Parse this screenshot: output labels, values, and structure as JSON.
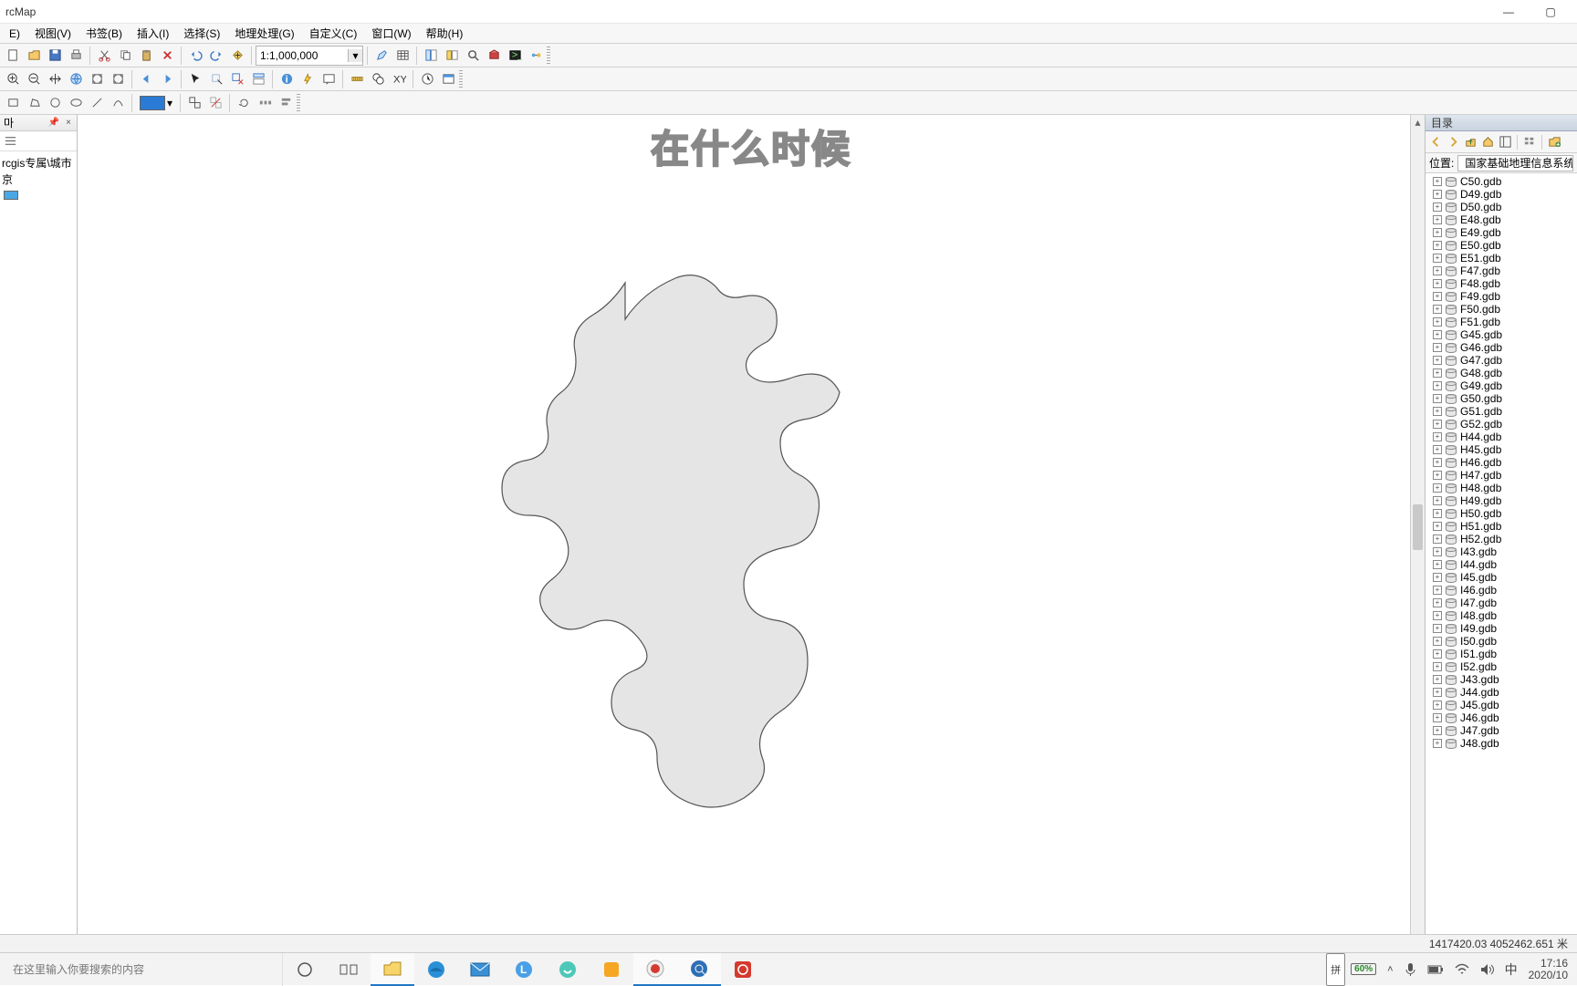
{
  "window": {
    "title": "rcMap",
    "minimize": "—",
    "close": "✕"
  },
  "menu": [
    "E)",
    "视图(V)",
    "书签(B)",
    "插入(I)",
    "选择(S)",
    "地理处理(G)",
    "自定义(C)",
    "窗口(W)",
    "帮助(H)"
  ],
  "toolbar1": {
    "scale": "1:1,000,000"
  },
  "toc": {
    "pin_title": "마",
    "layer_path": "rcgis专属\\城市",
    "layer_name": "京"
  },
  "overlay_text": "在什么时候",
  "catalog": {
    "title": "目录",
    "location_label": "位置:",
    "location_path": "国家基础地理信息系统",
    "items": [
      "C50.gdb",
      "D49.gdb",
      "D50.gdb",
      "E48.gdb",
      "E49.gdb",
      "E50.gdb",
      "E51.gdb",
      "F47.gdb",
      "F48.gdb",
      "F49.gdb",
      "F50.gdb",
      "F51.gdb",
      "G45.gdb",
      "G46.gdb",
      "G47.gdb",
      "G48.gdb",
      "G49.gdb",
      "G50.gdb",
      "G51.gdb",
      "G52.gdb",
      "H44.gdb",
      "H45.gdb",
      "H46.gdb",
      "H47.gdb",
      "H48.gdb",
      "H49.gdb",
      "H50.gdb",
      "H51.gdb",
      "H52.gdb",
      "I43.gdb",
      "I44.gdb",
      "I45.gdb",
      "I46.gdb",
      "I47.gdb",
      "I48.gdb",
      "I49.gdb",
      "I50.gdb",
      "I51.gdb",
      "I52.gdb",
      "J43.gdb",
      "J44.gdb",
      "J45.gdb",
      "J46.gdb",
      "J47.gdb",
      "J48.gdb"
    ]
  },
  "status": {
    "coords": "1417420.03  4052462.651 米"
  },
  "taskbar": {
    "search_placeholder": "在这里输入你要搜索的内容",
    "ime_pin": "拼",
    "battery": "60%",
    "ime_lang": "中",
    "time": "17:16",
    "date": "2020/10"
  }
}
